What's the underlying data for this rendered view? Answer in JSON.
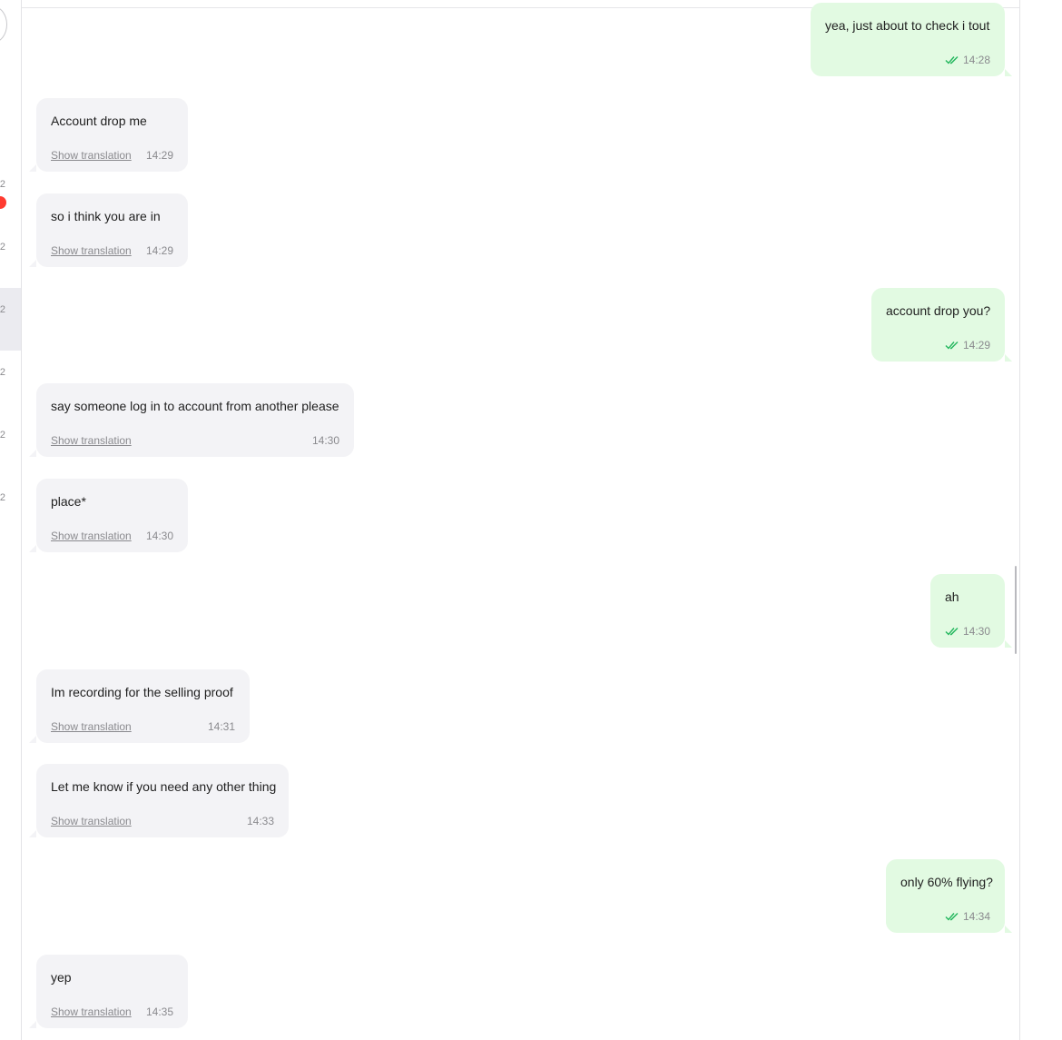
{
  "sidebar": {
    "dates": [
      "2",
      "2",
      "2",
      "2",
      "2",
      "2"
    ],
    "colors": {
      "badge": "#ff3b30",
      "active_row": "#ebebf0"
    }
  },
  "chat": {
    "colors": {
      "incoming_bubble": "#f3f3f6",
      "outgoing_bubble": "#e2fae2",
      "read_check": "#21b65c"
    },
    "messages": [
      {
        "direction": "out",
        "text": "yea, just about to check i tout",
        "time": "14:28",
        "status_icon": "double-check-icon"
      },
      {
        "direction": "in",
        "text": "Account drop me",
        "translation_link": "Show translation",
        "time": "14:29"
      },
      {
        "direction": "in",
        "text": "so i think you are in",
        "translation_link": "Show translation",
        "time": "14:29"
      },
      {
        "direction": "out",
        "text": "account drop you?",
        "time": "14:29",
        "status_icon": "double-check-icon"
      },
      {
        "direction": "in",
        "text": "say someone log in to account from another please",
        "translation_link": "Show translation",
        "time": "14:30"
      },
      {
        "direction": "in",
        "text": "place*",
        "translation_link": "Show translation",
        "time": "14:30"
      },
      {
        "direction": "out",
        "text": "ah",
        "time": "14:30",
        "status_icon": "double-check-icon"
      },
      {
        "direction": "in",
        "text": "Im recording for the selling proof",
        "translation_link": "Show translation",
        "time": "14:31"
      },
      {
        "direction": "in",
        "text": "Let me know if you need any other thing",
        "translation_link": "Show translation",
        "time": "14:33"
      },
      {
        "direction": "out",
        "text": "only 60% flying?",
        "time": "14:34",
        "status_icon": "double-check-icon"
      },
      {
        "direction": "in",
        "text": "yep",
        "translation_link": "Show translation",
        "time": "14:35"
      }
    ]
  }
}
